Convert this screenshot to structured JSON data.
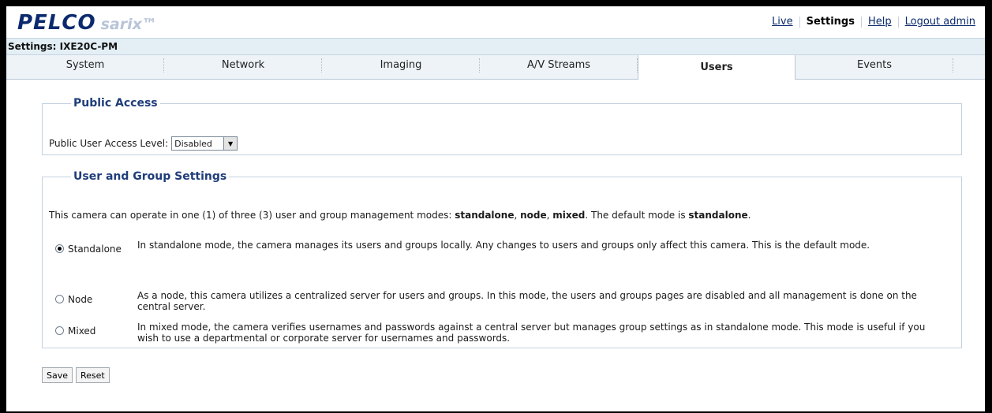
{
  "brand": {
    "logo": "PELCO",
    "product": "sarix™"
  },
  "topnav": {
    "live": "Live",
    "settings": "Settings",
    "help": "Help",
    "logout": "Logout admin"
  },
  "title": "Settings: IXE20C-PM",
  "tabs": [
    {
      "label": "System"
    },
    {
      "label": "Network"
    },
    {
      "label": "Imaging"
    },
    {
      "label": "A/V Streams"
    },
    {
      "label": "Users",
      "active": true
    },
    {
      "label": "Events"
    }
  ],
  "public_access": {
    "legend": "Public Access",
    "level_label": "Public User Access Level:",
    "level_value": "Disabled"
  },
  "user_group": {
    "legend": "User and Group Settings",
    "intro": {
      "p1": "This camera can operate in one (1) of three (3) user and group management modes: ",
      "standalone": "standalone",
      "comma1": ", ",
      "node": "node",
      "comma2": ", ",
      "mixed": "mixed",
      "p2": ". The default mode is ",
      "default": "standalone",
      "p3": "."
    },
    "modes": [
      {
        "label": "Standalone",
        "checked": true,
        "desc": "In standalone mode, the camera manages its users and groups locally. Any changes to users and groups only affect this camera. This is the default mode."
      },
      {
        "label": "Node",
        "checked": false,
        "desc": "As a node, this camera utilizes a centralized server for users and groups. In this mode, the users and groups pages are disabled and all management is done on the central server."
      },
      {
        "label": "Mixed",
        "checked": false,
        "desc": "In mixed mode, the camera verifies usernames and passwords against a central server but manages group settings as in standalone mode. This mode is useful if you wish to use a departmental or corporate server for usernames and passwords."
      }
    ]
  },
  "actions": {
    "save": "Save",
    "reset": "Reset"
  }
}
